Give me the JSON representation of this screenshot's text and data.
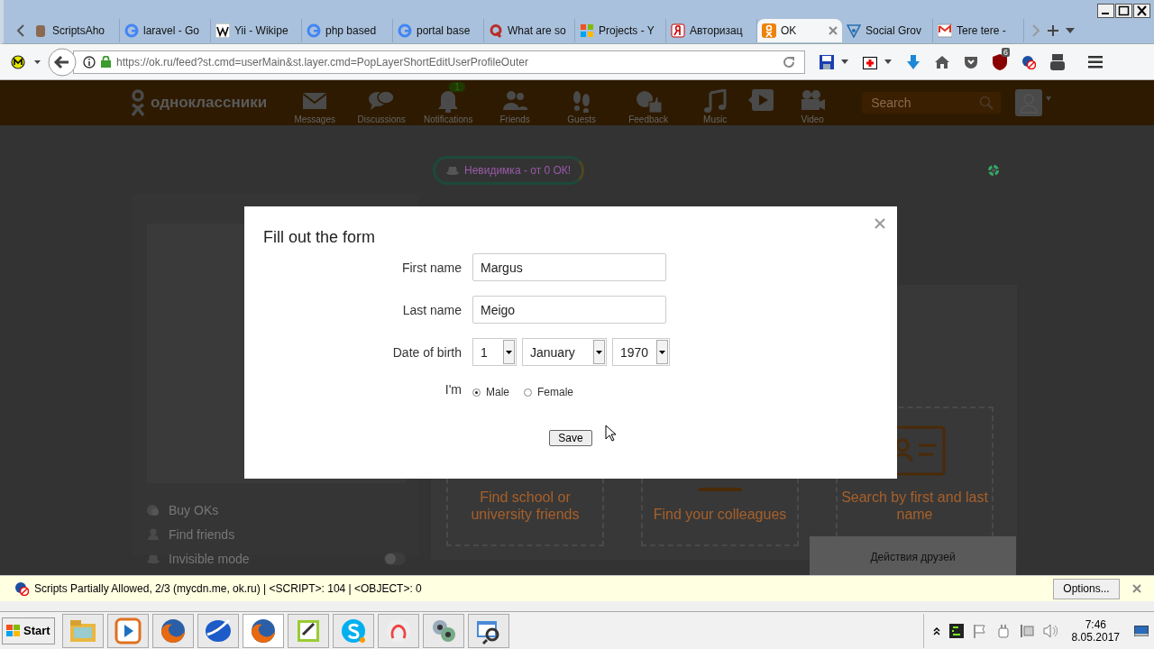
{
  "browser": {
    "tabs": [
      {
        "title": "ScriptsAho",
        "selected": false
      },
      {
        "title": "laravel - Go",
        "selected": false
      },
      {
        "title": "Yii - Wikipe",
        "selected": false
      },
      {
        "title": "php based",
        "selected": false
      },
      {
        "title": "portal base",
        "selected": false
      },
      {
        "title": "What are so",
        "selected": false
      },
      {
        "title": "Projects - Y",
        "selected": false
      },
      {
        "title": "Авторизац",
        "selected": false
      },
      {
        "title": "OK",
        "selected": true
      },
      {
        "title": "Social Grov",
        "selected": false
      },
      {
        "title": "Tere tere -",
        "selected": false
      }
    ],
    "url": "https://ok.ru/feed?st.cmd=userMain&st.layer.cmd=PopLayerShortEditUserProfileOuter",
    "addon_badge": "6"
  },
  "site": {
    "logo": "одноклассники",
    "nav": [
      {
        "label": "Messages"
      },
      {
        "label": "Discussions"
      },
      {
        "label": "Notifications",
        "badge": "1"
      },
      {
        "label": "Friends"
      },
      {
        "label": "Guests"
      },
      {
        "label": "Feedback"
      },
      {
        "label": "Music"
      },
      {
        "label": "Video"
      }
    ],
    "search": {
      "placeholder": "Search"
    },
    "promo": "Невидимка - от 0 ОК!",
    "side_menu": [
      {
        "label": "Buy OKs",
        "kind": "link"
      },
      {
        "label": "Find friends",
        "kind": "link"
      },
      {
        "label": "Invisible mode",
        "kind": "toggle",
        "on": false
      }
    ],
    "cards": [
      "Find school or university friends",
      "Find your colleagues",
      "Search by first and last name"
    ],
    "friends_panel": "Действия друзей"
  },
  "dialog": {
    "title": "Fill out the form",
    "first_name": {
      "label": "First name",
      "value": "Margus"
    },
    "last_name": {
      "label": "Last name",
      "value": "Meigo"
    },
    "birth": {
      "label": "Date of birth",
      "day": "1",
      "month": "January",
      "year": "1970"
    },
    "gender": {
      "label": "I'm",
      "options": [
        {
          "label": "Male",
          "selected": true
        },
        {
          "label": "Female",
          "selected": false
        }
      ]
    },
    "save": "Save"
  },
  "notification_bar": {
    "message": "Scripts Partially Allowed, 2/3 (mycdn.me, ok.ru) | <SCRIPT>: 104 | <OBJECT>: 0",
    "button": "Options..."
  },
  "taskbar": {
    "start": "Start",
    "time": "7:46",
    "date": "8.05.2017"
  }
}
